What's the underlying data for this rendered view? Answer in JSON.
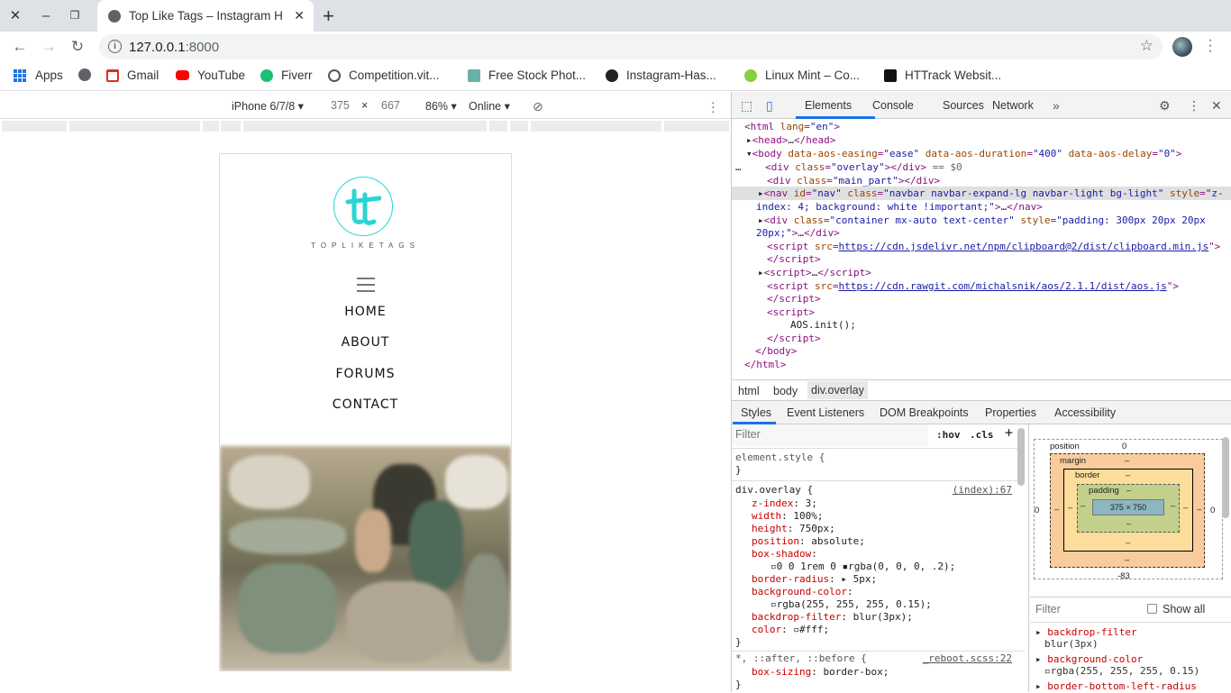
{
  "browser": {
    "tab_title": "Top Like Tags – Instagram H",
    "url_host": "127.0.0.1",
    "url_port": ":8000",
    "bookmarks": [
      {
        "label": "Apps",
        "icon": "apps-grid-icon"
      },
      {
        "label": "",
        "icon": "globe-icon"
      },
      {
        "label": "Gmail",
        "icon": "gmail-icon"
      },
      {
        "label": "YouTube",
        "icon": "youtube-icon"
      },
      {
        "label": "Fiverr",
        "icon": "fiverr-icon"
      },
      {
        "label": "Competition.vit...",
        "icon": "competition-icon"
      },
      {
        "label": "Free Stock Phot...",
        "icon": "stock-photo-icon"
      },
      {
        "label": "Instagram-Has...",
        "icon": "github-icon"
      },
      {
        "label": "Linux Mint – Co...",
        "icon": "linux-mint-icon"
      },
      {
        "label": "HTTrack Websit...",
        "icon": "httrack-icon"
      }
    ]
  },
  "device_toolbar": {
    "device": "iPhone 6/7/8",
    "width": "375",
    "times": "×",
    "height": "667",
    "zoom": "86%",
    "network": "Online"
  },
  "site": {
    "logo_text": "TOPLIKETAGS",
    "nav": [
      "HOME",
      "ABOUT",
      "FORUMS",
      "CONTACT"
    ]
  },
  "devtools": {
    "tabs": [
      "Elements",
      "Console",
      "Sources",
      "Network"
    ],
    "breadcrumbs": [
      "html",
      "body",
      "div.overlay"
    ],
    "subtabs": [
      "Styles",
      "Event Listeners",
      "DOM Breakpoints",
      "Properties",
      "Accessibility"
    ],
    "filter_placeholder": "Filter",
    "hov": ":hov",
    "cls": ".cls",
    "element_style": "element.style {",
    "rule_selector": "div.overlay {",
    "rule_source": "(index):67",
    "reboot_selector": "*, ::after, ::before {",
    "reboot_source": "_reboot.scss:22",
    "box": {
      "position_label": "position",
      "position_value": "0",
      "margin_label": "margin",
      "border_label": "border",
      "padding_label": "padding",
      "content": "375 × 750",
      "dash": "–",
      "bottom_offset": "-83",
      "zero": "0"
    },
    "computed_filter": "Filter",
    "show_all": "Show all"
  },
  "colors": {
    "accent": "#1a73e8",
    "logo": "#2ad4d4",
    "tag": "#881280",
    "attr": "#994500",
    "value": "#1a1aa6",
    "prop": "#c80000"
  }
}
